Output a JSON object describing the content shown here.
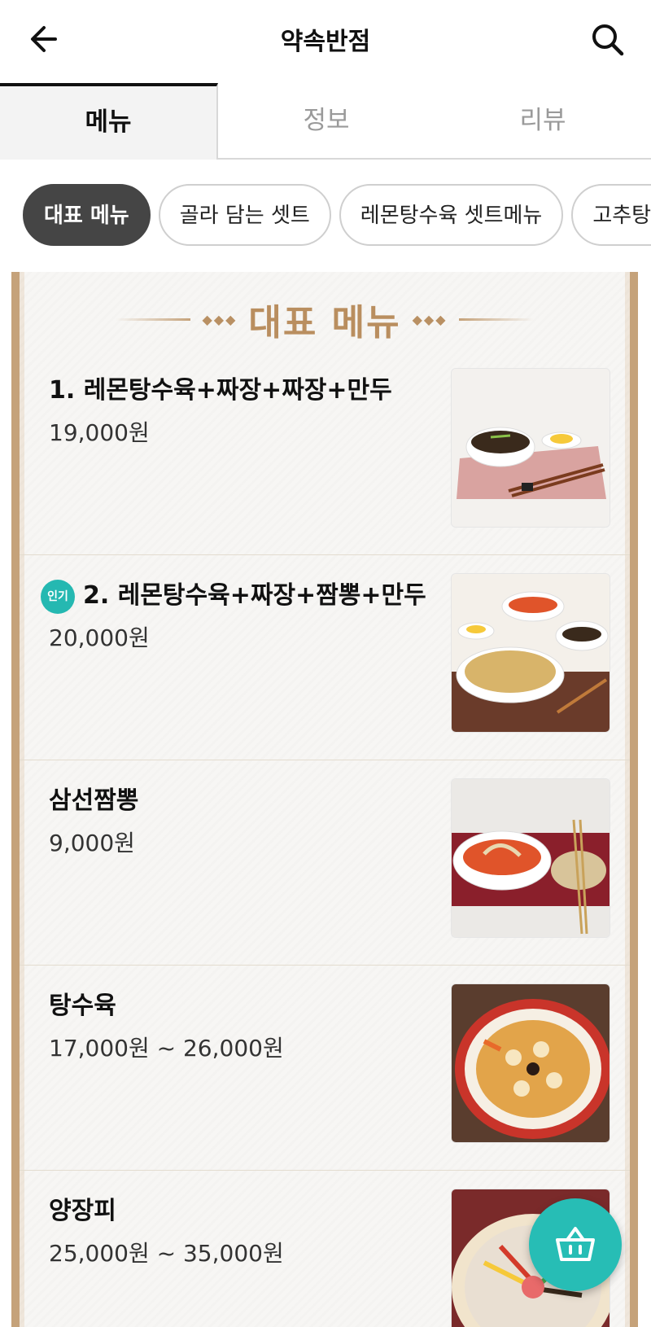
{
  "header": {
    "title": "약속반점"
  },
  "tabs": [
    {
      "label": "메뉴",
      "active": true
    },
    {
      "label": "정보",
      "active": false
    },
    {
      "label": "리뷰",
      "active": false
    }
  ],
  "chips": [
    {
      "label": "대표 메뉴",
      "active": true
    },
    {
      "label": "골라 담는 셋트",
      "active": false
    },
    {
      "label": "레몬탕수육 셋트메뉴",
      "active": false
    },
    {
      "label": "고추탕수",
      "active": false
    }
  ],
  "board": {
    "title": "대표 메뉴",
    "items": [
      {
        "name": "1. 레몬탕수육+짜장+짜장+만두",
        "price": "19,000원",
        "badge": "",
        "image": "jajang-set-photo"
      },
      {
        "name": "2. 레몬탕수육+짜장+짬뽕+만두",
        "price": "20,000원",
        "badge": "인기",
        "image": "tangsuyuk-set-photo"
      },
      {
        "name": "삼선짬뽕",
        "price": "9,000원",
        "badge": "",
        "image": "jjambbong-photo"
      },
      {
        "name": "탕수육",
        "price": "17,000원 ~ 26,000원",
        "badge": "",
        "image": "tangsuyuk-photo"
      },
      {
        "name": "양장피",
        "price": "25,000원 ~ 35,000원",
        "badge": "",
        "image": "yangjangpi-photo"
      }
    ]
  },
  "icons": {
    "back": "arrow-left-icon",
    "search": "search-icon",
    "cart": "basket-icon"
  },
  "colors": {
    "accent": "#27bdb5",
    "board_gold": "#b98e5f",
    "chip_active": "#454545"
  }
}
